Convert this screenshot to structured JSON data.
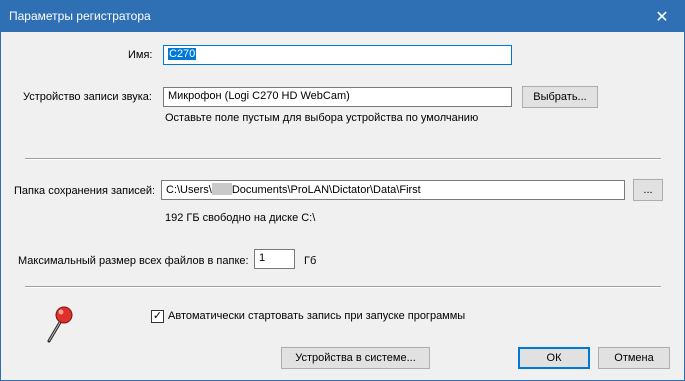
{
  "window": {
    "title": "Параметры регистратора",
    "close_glyph": "✕"
  },
  "name": {
    "label": "Имя:",
    "value": "C270"
  },
  "audio": {
    "label": "Устройство записи звука:",
    "value": "Микрофон (Logi C270 HD WebCam)",
    "choose_button": "Выбрать...",
    "hint": "Оставьте поле пустым для выбора устройства по умолчанию"
  },
  "folder": {
    "label": "Папка сохранения записей:",
    "path_prefix": "C:\\Users\\",
    "path_suffix": "Documents\\ProLAN\\Dictator\\Data\\First",
    "browse_button": "...",
    "free_space": "192 ГБ свободно на диске C:\\"
  },
  "max_size": {
    "label": "Максимальный размер всех файлов в папке:",
    "value": "1",
    "unit": "Гб"
  },
  "autostart": {
    "checked": true,
    "check_glyph": "✓",
    "label": "Автоматически стартовать запись при запуске программы"
  },
  "footer": {
    "devices_button": "Устройства в системе...",
    "ok_button": "ОК",
    "cancel_button": "Отмена"
  },
  "icons": {
    "microphone": "microphone-icon"
  },
  "colors": {
    "titlebar": "#2f6fb3",
    "focus": "#0078d7",
    "mic_head": "#e0302a"
  }
}
